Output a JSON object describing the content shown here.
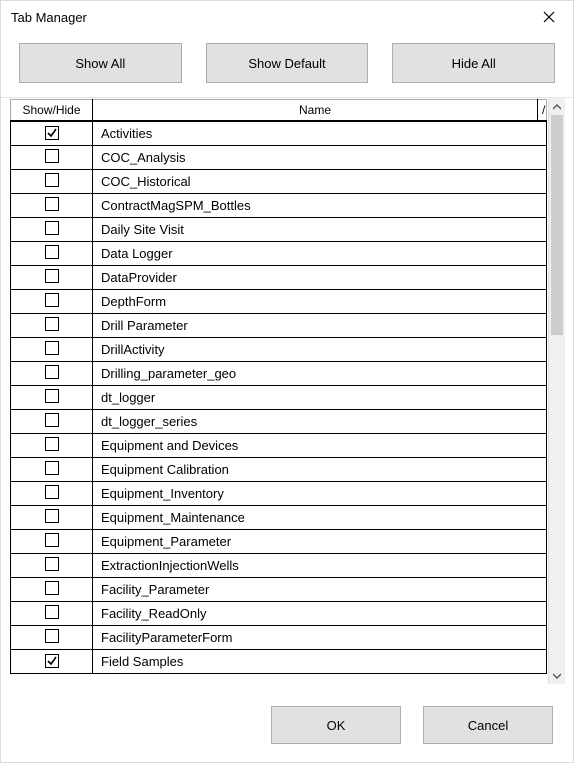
{
  "window": {
    "title": "Tab Manager"
  },
  "toolbar": {
    "show_all": "Show All",
    "show_default": "Show Default",
    "hide_all": "Hide All"
  },
  "grid": {
    "columns": {
      "show_hide": "Show/Hide",
      "name": "Name"
    },
    "rows": [
      {
        "checked": true,
        "name": "Activities"
      },
      {
        "checked": false,
        "name": "COC_Analysis"
      },
      {
        "checked": false,
        "name": "COC_Historical"
      },
      {
        "checked": false,
        "name": "ContractMagSPM_Bottles"
      },
      {
        "checked": false,
        "name": "Daily Site Visit"
      },
      {
        "checked": false,
        "name": "Data Logger"
      },
      {
        "checked": false,
        "name": "DataProvider"
      },
      {
        "checked": false,
        "name": "DepthForm"
      },
      {
        "checked": false,
        "name": "Drill Parameter"
      },
      {
        "checked": false,
        "name": "DrillActivity"
      },
      {
        "checked": false,
        "name": "Drilling_parameter_geo"
      },
      {
        "checked": false,
        "name": "dt_logger"
      },
      {
        "checked": false,
        "name": "dt_logger_series"
      },
      {
        "checked": false,
        "name": "Equipment and Devices"
      },
      {
        "checked": false,
        "name": "Equipment Calibration"
      },
      {
        "checked": false,
        "name": "Equipment_Inventory"
      },
      {
        "checked": false,
        "name": "Equipment_Maintenance"
      },
      {
        "checked": false,
        "name": "Equipment_Parameter"
      },
      {
        "checked": false,
        "name": "ExtractionInjectionWells"
      },
      {
        "checked": false,
        "name": "Facility_Parameter"
      },
      {
        "checked": false,
        "name": "Facility_ReadOnly"
      },
      {
        "checked": false,
        "name": "FacilityParameterForm"
      },
      {
        "checked": true,
        "name": "Field Samples"
      }
    ]
  },
  "footer": {
    "ok": "OK",
    "cancel": "Cancel"
  }
}
